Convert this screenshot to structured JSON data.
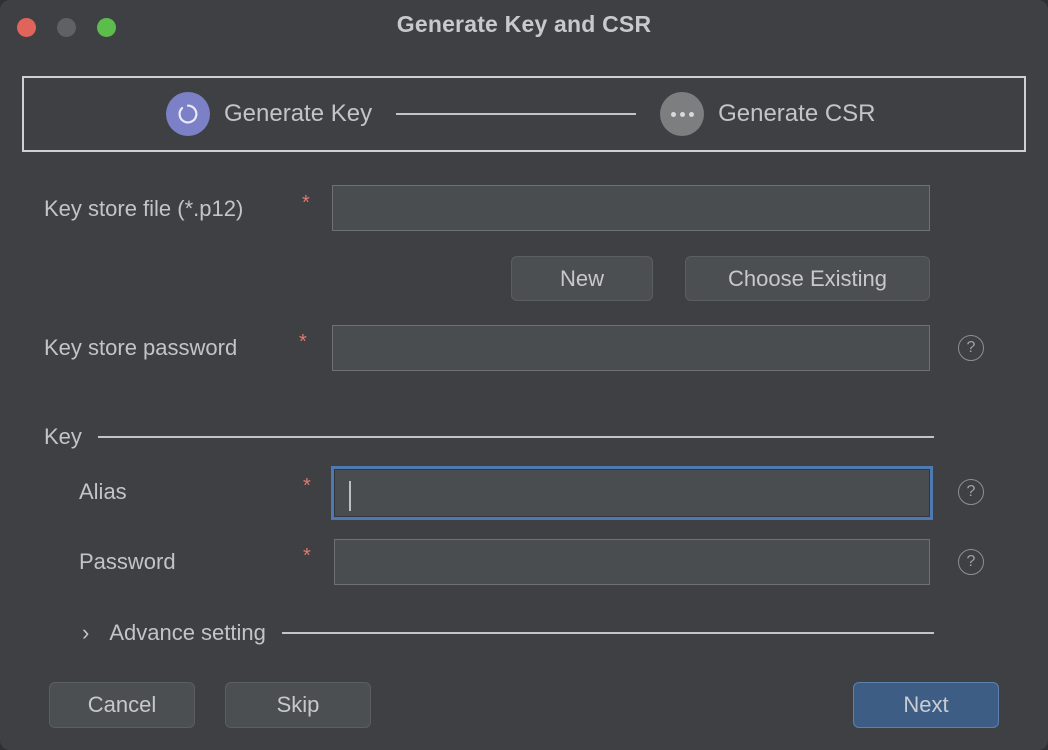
{
  "window": {
    "title": "Generate Key and CSR",
    "controls": [
      {
        "name": "close",
        "color": "#e0645c"
      },
      {
        "name": "minimize",
        "color": "#5f6265"
      },
      {
        "name": "maximize",
        "color": "#5cbc4c"
      }
    ]
  },
  "stepper": {
    "steps": [
      {
        "label": "Generate Key",
        "state": "active",
        "icon": "spinner-ring-icon",
        "color": "#7b80c7"
      },
      {
        "label": "Generate CSR",
        "state": "pending",
        "icon": "ellipsis-icon",
        "color": "#7c7e80"
      }
    ]
  },
  "form": {
    "keystore_file": {
      "label": "Key store file (*.p12)",
      "required": "*",
      "value": "",
      "placeholder": ""
    },
    "new_button": "New",
    "choose_existing_button": "Choose Existing",
    "keystore_password": {
      "label": "Key store password",
      "required": "*",
      "value": "",
      "placeholder": "",
      "help": "?"
    },
    "key_section": {
      "title": "Key",
      "alias": {
        "label": "Alias",
        "required": "*",
        "value": "",
        "placeholder": "",
        "help": "?",
        "focused": true
      },
      "password": {
        "label": "Password",
        "required": "*",
        "value": "",
        "placeholder": "",
        "help": "?"
      }
    },
    "advance_setting": {
      "label": "Advance setting",
      "chevron": "›",
      "expanded": false
    }
  },
  "footer": {
    "cancel": "Cancel",
    "skip": "Skip",
    "next": "Next"
  }
}
